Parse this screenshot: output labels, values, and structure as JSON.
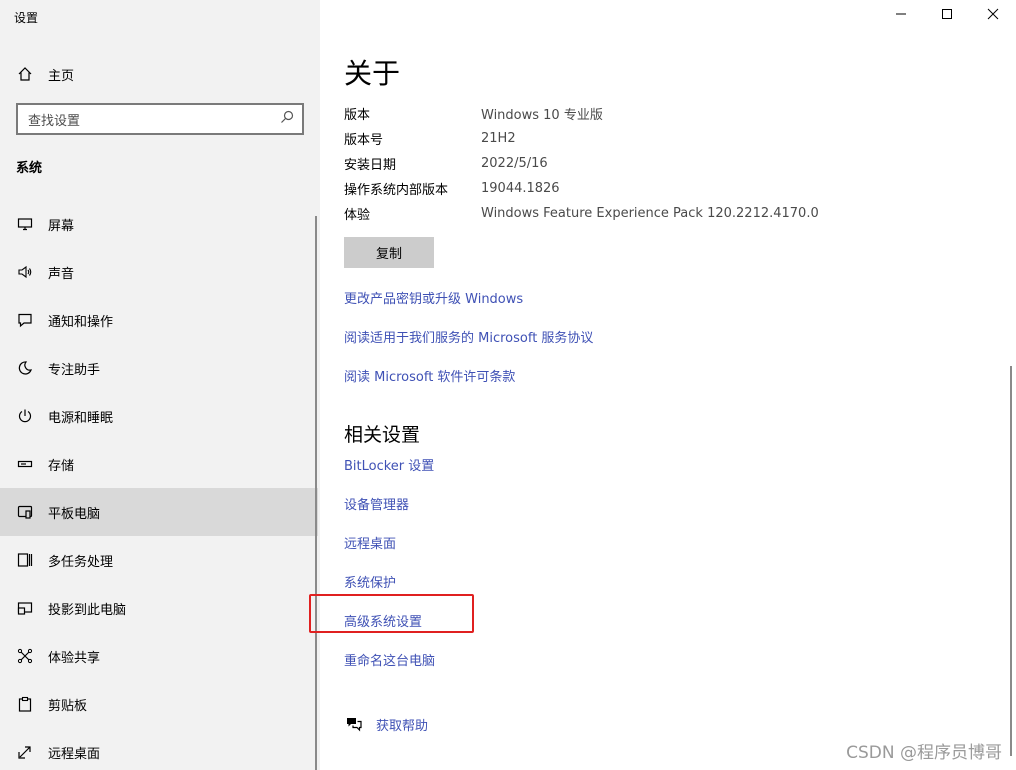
{
  "window": {
    "title": "设置",
    "controls": {
      "minimize": "minimize",
      "maximize": "maximize",
      "close": "close"
    }
  },
  "sidebar": {
    "home_label": "主页",
    "search_placeholder": "查找设置",
    "section_label": "系统",
    "items": [
      {
        "label": "屏幕",
        "icon": "monitor-icon"
      },
      {
        "label": "声音",
        "icon": "speaker-icon"
      },
      {
        "label": "通知和操作",
        "icon": "notification-icon"
      },
      {
        "label": "专注助手",
        "icon": "moon-icon"
      },
      {
        "label": "电源和睡眠",
        "icon": "power-icon"
      },
      {
        "label": "存储",
        "icon": "storage-icon"
      },
      {
        "label": "平板电脑",
        "icon": "tablet-icon",
        "selected": true
      },
      {
        "label": "多任务处理",
        "icon": "multitask-icon"
      },
      {
        "label": "投影到此电脑",
        "icon": "project-icon"
      },
      {
        "label": "体验共享",
        "icon": "share-icon"
      },
      {
        "label": "剪贴板",
        "icon": "clipboard-icon"
      },
      {
        "label": "远程桌面",
        "icon": "remote-icon"
      }
    ]
  },
  "main": {
    "title": "关于",
    "specs": [
      {
        "key": "版本",
        "value": "Windows 10 专业版"
      },
      {
        "key": "版本号",
        "value": "21H2"
      },
      {
        "key": "安装日期",
        "value": "2022/5/16"
      },
      {
        "key": "操作系统内部版本",
        "value": "19044.1826"
      },
      {
        "key": "体验",
        "value": "Windows Feature Experience Pack 120.2212.4170.0"
      }
    ],
    "copy_label": "复制",
    "links": [
      "更改产品密钥或升级 Windows",
      "阅读适用于我们服务的 Microsoft 服务协议",
      "阅读 Microsoft 软件许可条款"
    ],
    "related_title": "相关设置",
    "related_links": [
      "BitLocker 设置",
      "设备管理器",
      "远程桌面",
      "系统保护",
      "高级系统设置",
      "重命名这台电脑"
    ],
    "help_label": "获取帮助"
  },
  "watermark": "CSDN @程序员博哥",
  "colors": {
    "link": "#3f51b5",
    "highlight": "#e02020",
    "selected": "#d9d9d9",
    "sidebar_bg": "#f2f2f2"
  }
}
